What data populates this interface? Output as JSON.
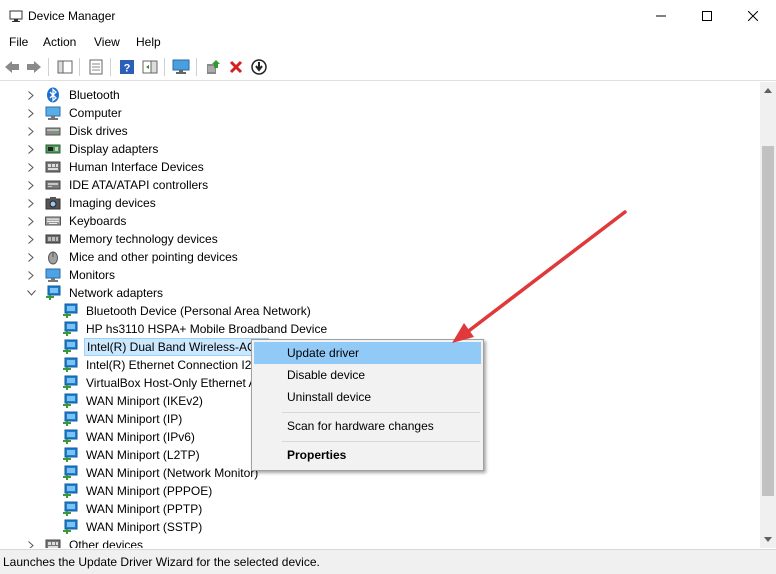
{
  "window": {
    "title": "Device Manager",
    "minimize_glyph": "—",
    "maximize_glyph": "☐",
    "close_glyph": "✕"
  },
  "menu": [
    "File",
    "Action",
    "View",
    "Help"
  ],
  "toolbar": {
    "icons": [
      "back-arrow-icon",
      "forward-arrow-icon",
      "show-hide-console-tree-icon",
      "properties-icon",
      "help-icon",
      "action-pane-icon",
      "monitor-icon",
      "update-driver-icon",
      "uninstall-icon",
      "disable-icon"
    ]
  },
  "tree": {
    "categories": [
      {
        "label": "Bluetooth",
        "icon": "bluetooth-icon",
        "expanded": false
      },
      {
        "label": "Computer",
        "icon": "computer-icon",
        "expanded": false
      },
      {
        "label": "Disk drives",
        "icon": "disk-drive-icon",
        "expanded": false
      },
      {
        "label": "Display adapters",
        "icon": "display-adapter-icon",
        "expanded": false
      },
      {
        "label": "Human Interface Devices",
        "icon": "hid-icon",
        "expanded": false
      },
      {
        "label": "IDE ATA/ATAPI controllers",
        "icon": "ide-controller-icon",
        "expanded": false
      },
      {
        "label": "Imaging devices",
        "icon": "camera-icon",
        "expanded": false
      },
      {
        "label": "Keyboards",
        "icon": "keyboard-icon",
        "expanded": false
      },
      {
        "label": "Memory technology devices",
        "icon": "memory-icon",
        "expanded": false
      },
      {
        "label": "Mice and other pointing devices",
        "icon": "mouse-icon",
        "expanded": false
      },
      {
        "label": "Monitors",
        "icon": "monitor-icon",
        "expanded": false
      },
      {
        "label": "Network adapters",
        "icon": "network-adapter-icon",
        "expanded": true
      }
    ],
    "network_adapters": [
      "Bluetooth Device (Personal Area Network)",
      "HP hs3110 HSPA+ Mobile Broadband Device",
      "Intel(R) Dual Band Wireless-AC 7",
      "Intel(R) Ethernet Connection I21",
      "VirtualBox Host-Only Ethernet A",
      "WAN Miniport (IKEv2)",
      "WAN Miniport (IP)",
      "WAN Miniport (IPv6)",
      "WAN Miniport (L2TP)",
      "WAN Miniport (Network Monitor)",
      "WAN Miniport (PPPOE)",
      "WAN Miniport (PPTP)",
      "WAN Miniport (SSTP)"
    ],
    "partial_category": "Other devices"
  },
  "context_menu": {
    "update_driver": "Update driver",
    "disable_device": "Disable device",
    "uninstall_device": "Uninstall device",
    "scan": "Scan for hardware changes",
    "properties": "Properties"
  },
  "status": "Launches the Update Driver Wizard for the selected device.",
  "colors": {
    "selection_bg": "#cce8ff",
    "menu_highlight": "#91c9f7",
    "annotation_arrow": "#e0393b",
    "network_icon": "#1e7fd0"
  }
}
